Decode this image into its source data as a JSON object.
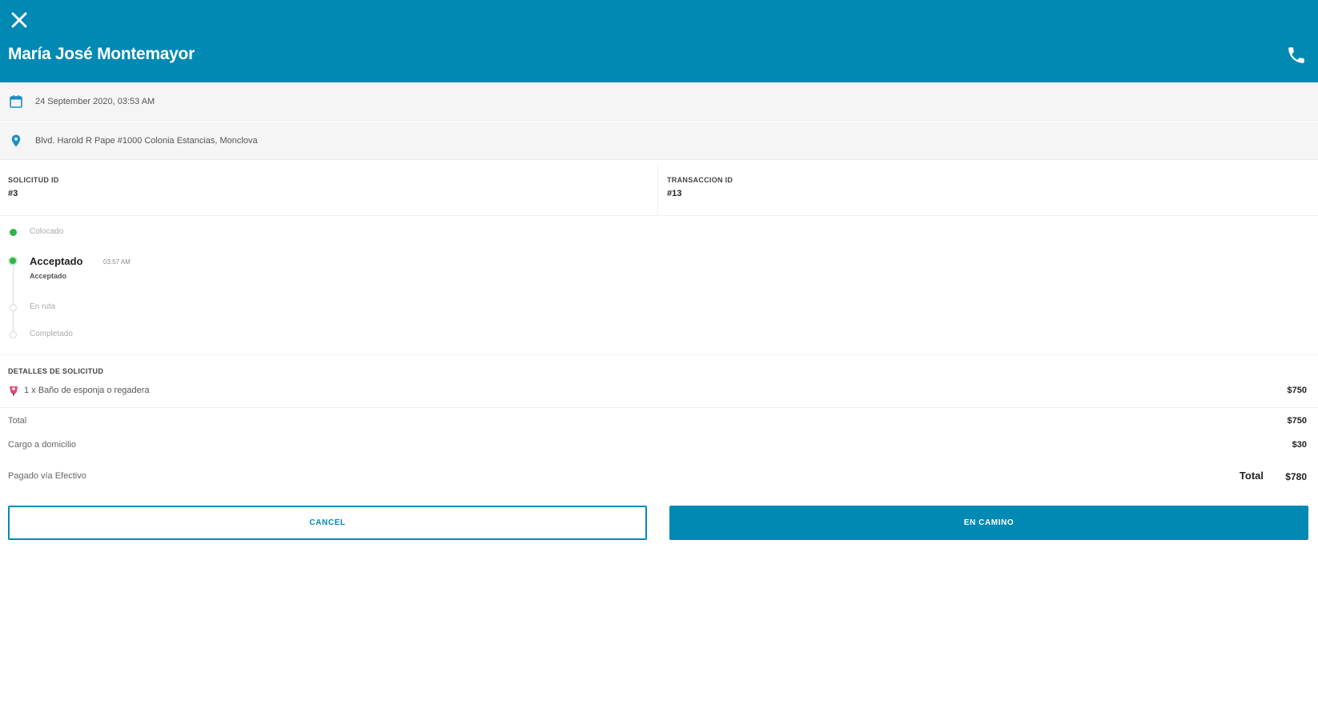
{
  "header": {
    "title": "María José Montemayor",
    "close_icon": "close-icon",
    "phone_icon": "phone-icon",
    "background": "#0089b3"
  },
  "info": {
    "date": "24 September 2020, 03:53 AM",
    "address": "Blvd. Harold R Pape #1000 Colonia Estancias, Monclova"
  },
  "ids": {
    "request_label": "SOLICITUD ID",
    "request_value": "#3",
    "transaction_label": "TRANSACCION ID",
    "transaction_value": "#13"
  },
  "timeline": [
    {
      "label": "Colocado",
      "state": "done"
    },
    {
      "label": "Acceptado",
      "state": "current",
      "time": "03:57 AM",
      "sub": "Acceptado"
    },
    {
      "label": "En ruta",
      "state": "pending"
    },
    {
      "label": "Completado",
      "state": "pending"
    }
  ],
  "details": {
    "title": "DETALLES DE SOLICITUD",
    "item_text": "1 x Baño de esponja o regadera",
    "item_price": "$750"
  },
  "summary": {
    "total_label": "Total",
    "total_value": "$750",
    "fee_label": "Cargo a domicilio",
    "fee_value": "$30",
    "paid_label": "Pagado vía Efectivo",
    "grand_label": "Total",
    "grand_value": "$780"
  },
  "actions": {
    "cancel_label": "CANCEL",
    "primary_label": "EN CAMINO"
  },
  "colors": {
    "accent": "#0089b3",
    "success": "#2fb34a"
  }
}
